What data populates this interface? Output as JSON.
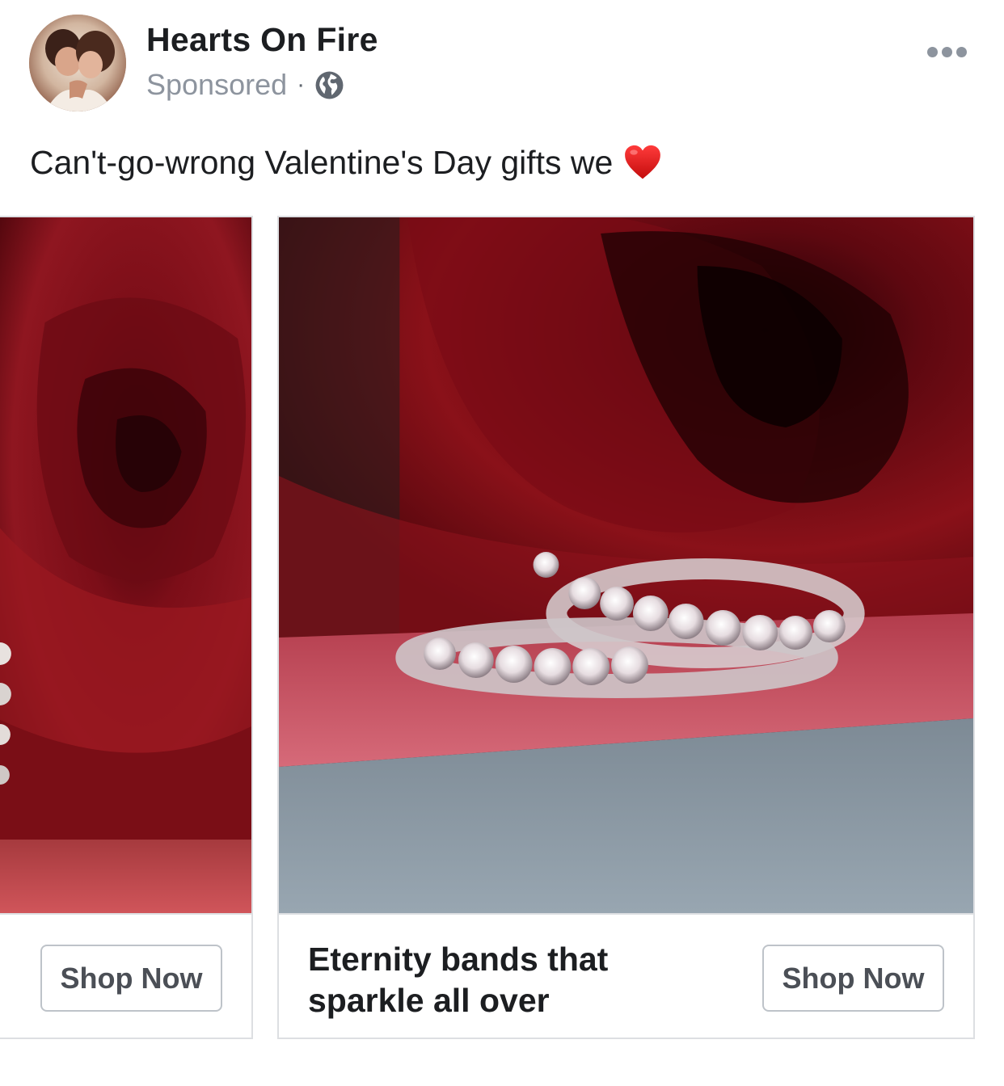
{
  "post": {
    "page_name": "Hearts On Fire",
    "sponsored_label": "Sponsored",
    "separator": "·",
    "privacy_icon": "globe-icon",
    "more_icon": "more-options-icon",
    "text": "Can't-go-wrong Valentine's Day gifts we",
    "emoji": "heart-icon"
  },
  "carousel": {
    "cards": [
      {
        "headline": "",
        "cta_label": "Shop Now",
        "image": "red rose with diamond earrings"
      },
      {
        "headline": "Eternity bands that sparkle all over",
        "cta_label": "Shop Now",
        "image": "two diamond eternity bands in front of red rose"
      }
    ]
  },
  "colors": {
    "text_primary": "#1c1e21",
    "text_secondary": "#8d949e",
    "border": "#dddfe2",
    "button_border": "#bec3c9",
    "rose_red": "#7a0a16"
  }
}
